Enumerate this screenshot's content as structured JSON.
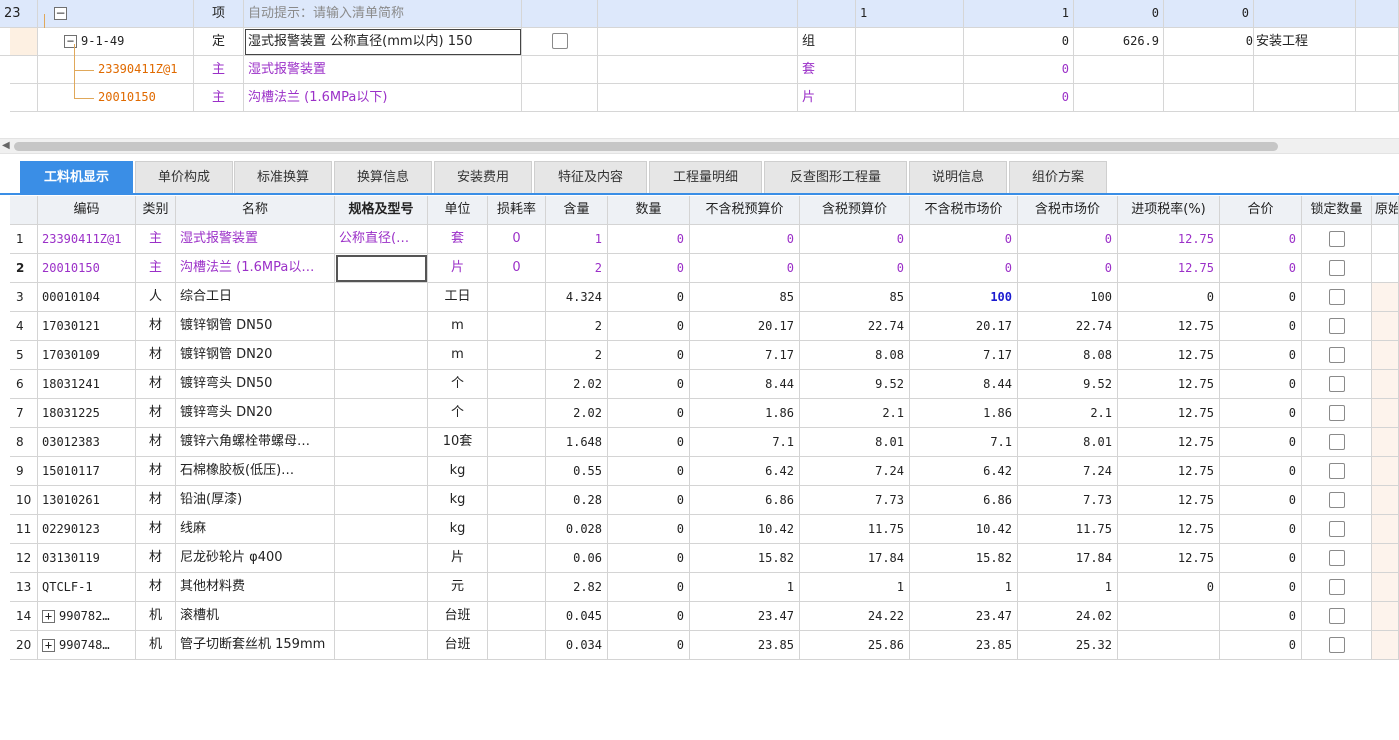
{
  "top_rows": [
    {
      "no": "23",
      "type": "项",
      "name": "自动提示：请输入清单简称",
      "c1": "1",
      "c2": "1",
      "c3": "0",
      "c4": "0"
    },
    {
      "code": "9-1-49",
      "type": "定",
      "name": "湿式报警装置 公称直径(mm以内) 150",
      "unit": "组",
      "qty": "0",
      "price": "626.9",
      "total": "0",
      "category": "安装工程"
    },
    {
      "code": "23390411Z@1",
      "type": "主",
      "name": "湿式报警装置",
      "unit": "套",
      "qty": "0"
    },
    {
      "code": "20010150",
      "type": "主",
      "name": "沟槽法兰 (1.6MPa以下)",
      "unit": "片",
      "qty": "0"
    }
  ],
  "tabs": [
    "工料机显示",
    "单价构成",
    "标准换算",
    "换算信息",
    "安装费用",
    "特征及内容",
    "工程量明细",
    "反查图形工程量",
    "说明信息",
    "组价方案"
  ],
  "columns": [
    "编码",
    "类别",
    "名称",
    "规格及型号",
    "单位",
    "损耗率",
    "含量",
    "数量",
    "不含税预算价",
    "含税预算价",
    "不含税市场价",
    "含税市场价",
    "进项税率(%)",
    "合价",
    "锁定数量",
    "原始"
  ],
  "rows": [
    {
      "idx": "1",
      "code": "23390411Z@1",
      "type": "主",
      "name": "湿式报警装置",
      "spec": "公称直径(…",
      "unit": "套",
      "loss": "0",
      "content": "1",
      "qty": "0",
      "p1": "0",
      "p2": "0",
      "p3": "0",
      "p4": "0",
      "tax": "12.75",
      "sum": "0"
    },
    {
      "idx": "2",
      "code": "20010150",
      "type": "主",
      "name": "沟槽法兰 (1.6MPa以…",
      "spec": "",
      "unit": "片",
      "loss": "0",
      "content": "2",
      "qty": "0",
      "p1": "0",
      "p2": "0",
      "p3": "0",
      "p4": "0",
      "tax": "12.75",
      "sum": "0"
    },
    {
      "idx": "3",
      "code": "00010104",
      "type": "人",
      "name": "综合工日",
      "spec": "",
      "unit": "工日",
      "loss": "",
      "content": "4.324",
      "qty": "0",
      "p1": "85",
      "p2": "85",
      "p3": "100",
      "p4": "100",
      "tax": "0",
      "sum": "0"
    },
    {
      "idx": "4",
      "code": "17030121",
      "type": "材",
      "name": "镀锌钢管 DN50",
      "spec": "",
      "unit": "m",
      "loss": "",
      "content": "2",
      "qty": "0",
      "p1": "20.17",
      "p2": "22.74",
      "p3": "20.17",
      "p4": "22.74",
      "tax": "12.75",
      "sum": "0"
    },
    {
      "idx": "5",
      "code": "17030109",
      "type": "材",
      "name": "镀锌钢管 DN20",
      "spec": "",
      "unit": "m",
      "loss": "",
      "content": "2",
      "qty": "0",
      "p1": "7.17",
      "p2": "8.08",
      "p3": "7.17",
      "p4": "8.08",
      "tax": "12.75",
      "sum": "0"
    },
    {
      "idx": "6",
      "code": "18031241",
      "type": "材",
      "name": "镀锌弯头 DN50",
      "spec": "",
      "unit": "个",
      "loss": "",
      "content": "2.02",
      "qty": "0",
      "p1": "8.44",
      "p2": "9.52",
      "p3": "8.44",
      "p4": "9.52",
      "tax": "12.75",
      "sum": "0"
    },
    {
      "idx": "7",
      "code": "18031225",
      "type": "材",
      "name": "镀锌弯头 DN20",
      "spec": "",
      "unit": "个",
      "loss": "",
      "content": "2.02",
      "qty": "0",
      "p1": "1.86",
      "p2": "2.1",
      "p3": "1.86",
      "p4": "2.1",
      "tax": "12.75",
      "sum": "0"
    },
    {
      "idx": "8",
      "code": "03012383",
      "type": "材",
      "name": "镀锌六角螺栓带螺母…",
      "spec": "",
      "unit": "10套",
      "loss": "",
      "content": "1.648",
      "qty": "0",
      "p1": "7.1",
      "p2": "8.01",
      "p3": "7.1",
      "p4": "8.01",
      "tax": "12.75",
      "sum": "0"
    },
    {
      "idx": "9",
      "code": "15010117",
      "type": "材",
      "name": "石棉橡胶板(低压)…",
      "spec": "",
      "unit": "kg",
      "loss": "",
      "content": "0.55",
      "qty": "0",
      "p1": "6.42",
      "p2": "7.24",
      "p3": "6.42",
      "p4": "7.24",
      "tax": "12.75",
      "sum": "0"
    },
    {
      "idx": "10",
      "code": "13010261",
      "type": "材",
      "name": "铅油(厚漆)",
      "spec": "",
      "unit": "kg",
      "loss": "",
      "content": "0.28",
      "qty": "0",
      "p1": "6.86",
      "p2": "7.73",
      "p3": "6.86",
      "p4": "7.73",
      "tax": "12.75",
      "sum": "0"
    },
    {
      "idx": "11",
      "code": "02290123",
      "type": "材",
      "name": "线麻",
      "spec": "",
      "unit": "kg",
      "loss": "",
      "content": "0.028",
      "qty": "0",
      "p1": "10.42",
      "p2": "11.75",
      "p3": "10.42",
      "p4": "11.75",
      "tax": "12.75",
      "sum": "0"
    },
    {
      "idx": "12",
      "code": "03130119",
      "type": "材",
      "name": "尼龙砂轮片 φ400",
      "spec": "",
      "unit": "片",
      "loss": "",
      "content": "0.06",
      "qty": "0",
      "p1": "15.82",
      "p2": "17.84",
      "p3": "15.82",
      "p4": "17.84",
      "tax": "12.75",
      "sum": "0"
    },
    {
      "idx": "13",
      "code": "QTCLF-1",
      "type": "材",
      "name": "其他材料费",
      "spec": "",
      "unit": "元",
      "loss": "",
      "content": "2.82",
      "qty": "0",
      "p1": "1",
      "p2": "1",
      "p3": "1",
      "p4": "1",
      "tax": "0",
      "sum": "0"
    },
    {
      "idx": "14",
      "code": "990782…",
      "type": "机",
      "name": "滚槽机",
      "spec": "",
      "unit": "台班",
      "loss": "",
      "content": "0.045",
      "qty": "0",
      "p1": "23.47",
      "p2": "24.22",
      "p3": "23.47",
      "p4": "24.02",
      "tax": "",
      "sum": "0",
      "expandable": true
    },
    {
      "idx": "20",
      "code": "990748…",
      "type": "机",
      "name": "管子切断套丝机 159mm",
      "spec": "",
      "unit": "台班",
      "loss": "",
      "content": "0.034",
      "qty": "0",
      "p1": "23.85",
      "p2": "25.86",
      "p3": "23.85",
      "p4": "25.32",
      "tax": "",
      "sum": "0",
      "expandable": true
    }
  ],
  "colors": {
    "accent": "#3a8ee6",
    "purple": "#9b30c8",
    "highlight_blue": "#1a1ad0",
    "selected_row": "#dde8fb"
  },
  "icons": {
    "collapse": "minus-box-icon",
    "expand": "plus-box-icon",
    "checkbox": "checkbox-icon",
    "scroll_left": "scroll-left-arrow-icon"
  }
}
